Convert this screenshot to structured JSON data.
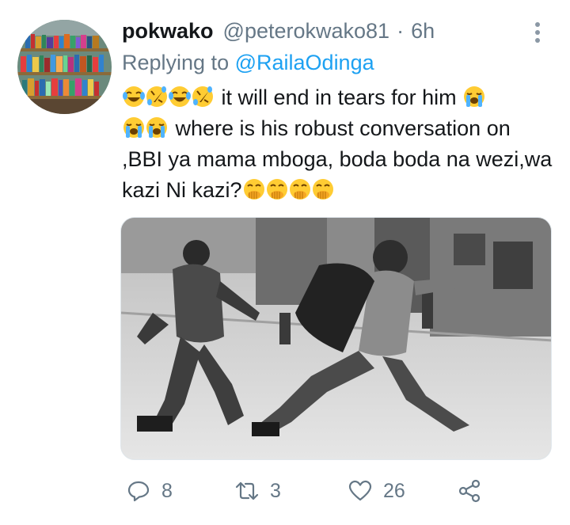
{
  "tweet": {
    "display_name": "pokwako",
    "handle": "@peterokwako81",
    "separator": "·",
    "time": "6h",
    "replying_prefix": "Replying to",
    "replying_to": "@RailaOdinga",
    "line1_text": " it will end in tears for him ",
    "line2_text": " where is his robust conversation on ,BBI ya mama mboga, boda boda na wezi,wa kazi Ni kazi?",
    "emojis": {
      "line1_lead": [
        "tears-of-joy",
        "rolling-on-floor-laughing",
        "tears-of-joy",
        "rolling-on-floor-laughing"
      ],
      "line1_end": [
        "loudly-crying"
      ],
      "line2_lead": [
        "loudly-crying",
        "loudly-crying"
      ],
      "line2_end": [
        "hand-over-mouth",
        "hand-over-mouth",
        "hand-over-mouth",
        "hand-over-mouth"
      ]
    }
  },
  "actions": {
    "reply_count": "8",
    "retweet_count": "3",
    "like_count": "26"
  },
  "colors": {
    "text": "#14171a",
    "secondary": "#657786",
    "link": "#1da1f2",
    "border": "#e1e8ed"
  }
}
